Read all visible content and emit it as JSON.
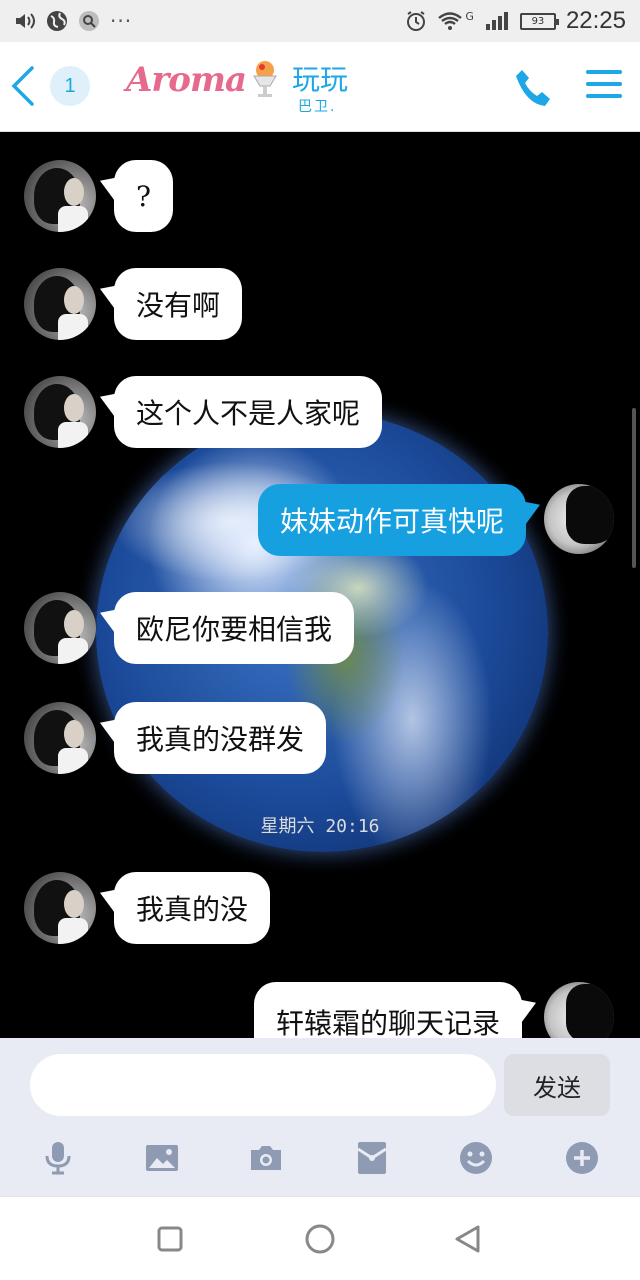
{
  "status_bar": {
    "time": "22:25",
    "battery_level": "93",
    "network_type": "G",
    "icons": [
      "volume-icon",
      "globe-icon",
      "search-icon",
      "more-dots-icon",
      "alarm-icon",
      "wifi-icon",
      "signal-icon",
      "battery-icon"
    ],
    "more": "···"
  },
  "header": {
    "unread_count": "1",
    "logo_text": "Aroma",
    "title": "玩玩",
    "subtitle": "巴卫.",
    "accent_color": "#1ea7e6"
  },
  "messages": [
    {
      "side": "left",
      "text": "?"
    },
    {
      "side": "left",
      "text": "没有啊"
    },
    {
      "side": "left",
      "text": "这个人不是人家呢"
    },
    {
      "side": "right",
      "text": "妹妹动作可真快呢"
    },
    {
      "side": "left",
      "text": "欧尼你要相信我"
    },
    {
      "side": "left",
      "text": "我真的没群发"
    },
    {
      "side": "left",
      "text": "我真的没"
    },
    {
      "side": "right",
      "text": "轩辕霜的聊天记录"
    }
  ],
  "timestamp": "星期六 20:16",
  "input": {
    "placeholder": "",
    "value": "",
    "send_label": "发送"
  },
  "toolbar_icons": [
    "microphone-icon",
    "image-icon",
    "camera-icon",
    "red-packet-icon",
    "emoji-icon",
    "plus-icon"
  ],
  "nav_icons": [
    "recent-apps-icon",
    "home-icon",
    "back-icon"
  ],
  "colors": {
    "outgoing_bubble": "#16a0e0",
    "incoming_bubble": "#ffffff",
    "chat_background": "#000000"
  }
}
